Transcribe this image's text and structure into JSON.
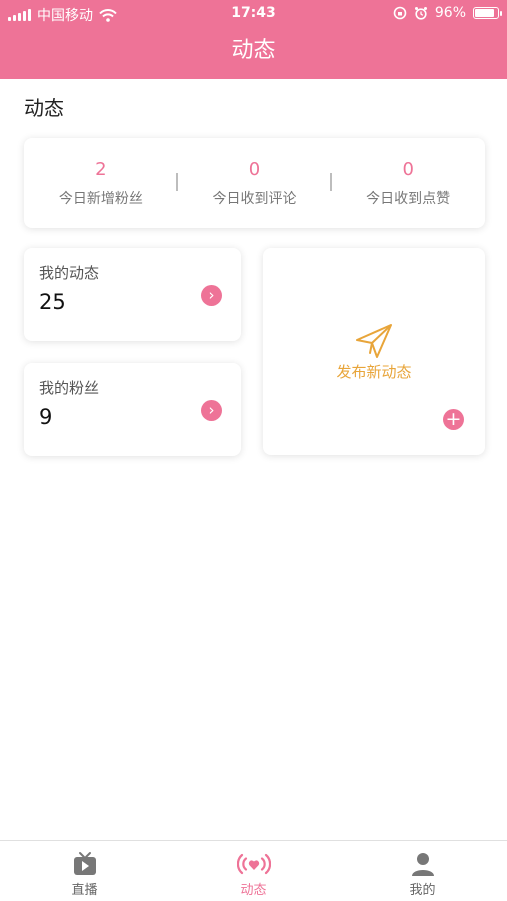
{
  "status_bar": {
    "carrier": "中国移动",
    "time": "17:43",
    "battery": "96%",
    "battery_level": 0.96
  },
  "nav": {
    "title": "动态"
  },
  "page": {
    "section_title": "动态"
  },
  "stats": [
    {
      "value": "2",
      "label": "今日新增粉丝"
    },
    {
      "value": "0",
      "label": "今日收到评论"
    },
    {
      "value": "0",
      "label": "今日收到点赞"
    }
  ],
  "cards": {
    "my_posts": {
      "title": "我的动态",
      "value": "25"
    },
    "my_fans": {
      "title": "我的粉丝",
      "value": "9"
    },
    "publish": {
      "label": "发布新动态"
    }
  },
  "tabbar": {
    "items": [
      {
        "label": "直播",
        "icon": "tv-play-icon"
      },
      {
        "label": "动态",
        "icon": "heart-signal-icon",
        "active": true
      },
      {
        "label": "我的",
        "icon": "person-icon"
      }
    ]
  },
  "colors": {
    "accent": "#ee7397",
    "publish_text": "#e8a53a"
  }
}
